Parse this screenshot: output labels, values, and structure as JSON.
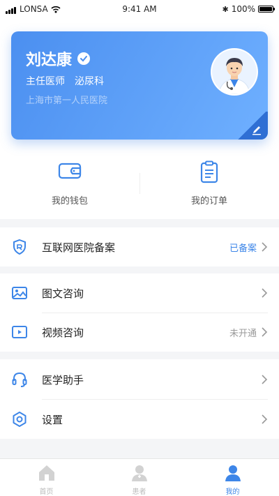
{
  "status_bar": {
    "carrier": "LONSA",
    "time": "9:41 AM",
    "battery": "100%"
  },
  "profile": {
    "name": "刘达康",
    "title": "主任医师",
    "department": "泌尿科",
    "hospital": "上海市第一人民医院"
  },
  "quick_actions": [
    {
      "label": "我的钱包",
      "icon": "wallet-icon"
    },
    {
      "label": "我的订单",
      "icon": "order-list-icon"
    }
  ],
  "menu": {
    "record": {
      "label": "互联网医院备案",
      "value": "已备案",
      "icon": "shield-icon"
    },
    "image_consult": {
      "label": "图文咨询",
      "value": "",
      "icon": "image-icon"
    },
    "video_consult": {
      "label": "视频咨询",
      "value": "未开通",
      "icon": "video-icon"
    },
    "assistant": {
      "label": "医学助手",
      "value": "",
      "icon": "headset-icon"
    },
    "settings": {
      "label": "设置",
      "value": "",
      "icon": "gear-icon"
    }
  },
  "tabs": [
    {
      "label": "首页",
      "icon": "home-icon",
      "active": false
    },
    {
      "label": "患者",
      "icon": "patients-icon",
      "active": false
    },
    {
      "label": "我的",
      "icon": "profile-icon",
      "active": true
    }
  ],
  "colors": {
    "accent": "#3d86e8",
    "card_start": "#4b8ff0",
    "card_end": "#6fb0ff",
    "background": "#f4f5f7"
  }
}
